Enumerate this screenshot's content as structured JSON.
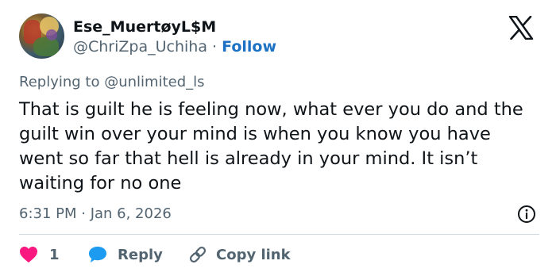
{
  "author": {
    "display_name": "Ese_MuertøyL$M",
    "handle": "@ChriZpa_Uchiha",
    "separator": "·",
    "follow_label": "Follow"
  },
  "reply_context": {
    "prefix": "Replying to",
    "mention": "@unlimited_ls"
  },
  "tweet": {
    "text": "That is guilt he is feeling now, what ever you do and the guilt win over your mind is when you know you have went so far that hell is already in your mind. It isn’t waiting for no one",
    "timestamp": "6:31 PM · Jan 6, 2026"
  },
  "actions": {
    "like_count": "1",
    "reply_label": "Reply",
    "copy_link_label": "Copy link"
  },
  "icons": {
    "brand": "x-logo-icon",
    "info": "info-icon",
    "like": "heart-icon",
    "reply": "speech-bubble-icon",
    "copy": "link-icon"
  },
  "colors": {
    "follow": "#1d72c4",
    "heart": "#f91880",
    "reply_bubble": "#1d9bf0",
    "secondary_text": "#536471",
    "divider": "#cfd9de"
  }
}
